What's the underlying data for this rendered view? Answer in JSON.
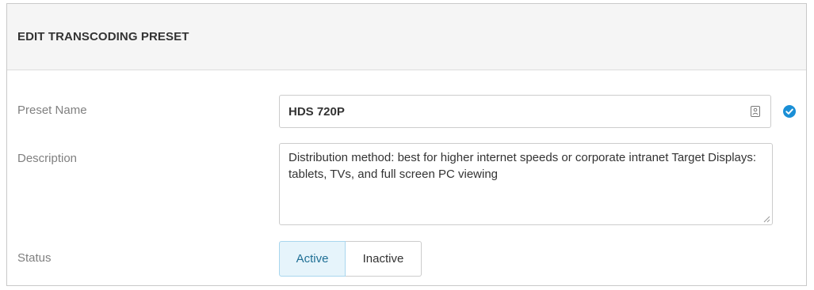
{
  "header": {
    "title": "EDIT TRANSCODING PRESET"
  },
  "form": {
    "preset_name": {
      "label": "Preset Name",
      "value": "HDS 720P",
      "field_icon": "contact-card-icon",
      "status_icon": "check-circle-icon"
    },
    "description": {
      "label": "Description",
      "value": "Distribution method: best for higher internet speeds or corporate intranet Target Displays: tablets, TVs, and full screen PC viewing"
    },
    "status": {
      "label": "Status",
      "options": [
        "Active",
        "Inactive"
      ],
      "selected": "Active"
    }
  },
  "colors": {
    "accent": "#1a8fd6",
    "active_bg": "#e6f4fb",
    "active_text": "#1f6f95"
  }
}
